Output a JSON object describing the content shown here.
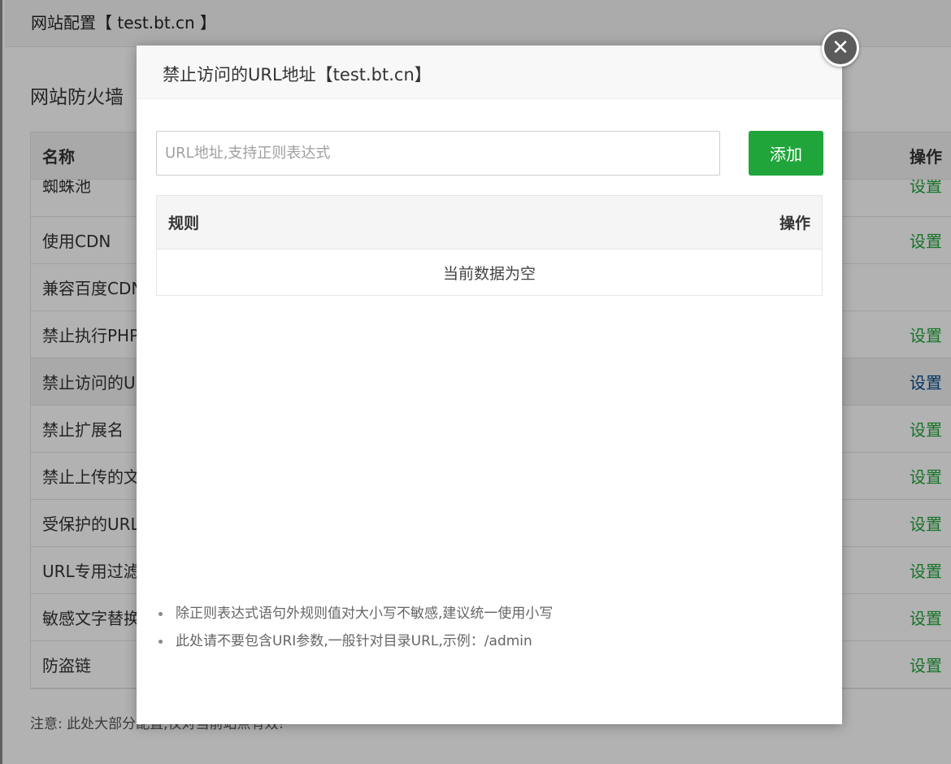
{
  "background": {
    "window_title": "网站配置【 test.bt.cn 】",
    "section_title": "网站防火墙",
    "table": {
      "col_name": "名称",
      "col_action": "操作",
      "partial_row": {
        "name": "蜘蛛池",
        "action": "设置"
      },
      "rows": [
        {
          "name": "使用CDN",
          "action": "设置"
        },
        {
          "name": "兼容百度CDN",
          "action": ""
        },
        {
          "name": "禁止执行PHP",
          "action": "设置"
        },
        {
          "name": "禁止访问的URL",
          "action": "设置"
        },
        {
          "name": "禁止扩展名",
          "action": "设置"
        },
        {
          "name": "禁止上传的文",
          "action": "设置"
        },
        {
          "name": "受保护的URL",
          "action": "设置"
        },
        {
          "name": "URL专用过滤",
          "action": "设置"
        },
        {
          "name": "敏感文字替换",
          "action": "设置"
        },
        {
          "name": "防盗链",
          "action": "设置"
        }
      ]
    },
    "note": "注意: 此处大部分配置,仅对当前站点有效!"
  },
  "modal": {
    "title": "禁止访问的URL地址【test.bt.cn】",
    "close_symbol": "✕",
    "input": {
      "placeholder": "URL地址,支持正则表达式",
      "value": ""
    },
    "add_label": "添加",
    "rule_table": {
      "col_rule": "规则",
      "col_action": "操作",
      "empty_text": "当前数据为空"
    },
    "tips": [
      "除正则表达式语句外规则值对大小写不敏感,建议统一使用小写",
      "此处请不要包含URI参数,一般针对目录URL,示例：/admin"
    ]
  },
  "colors": {
    "accent_green": "#20a53a",
    "link_blue": "#0a4a8c"
  }
}
